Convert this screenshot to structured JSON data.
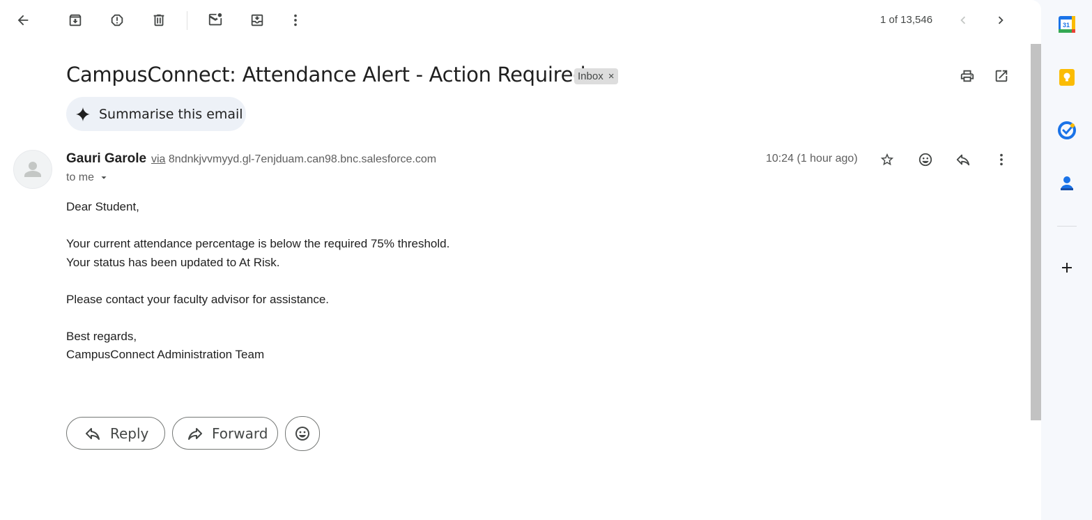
{
  "toolbar": {
    "back": "back-arrow-icon",
    "archive": "archive-icon",
    "report_spam": "report-spam-icon",
    "delete": "delete-icon",
    "mark_unread": "mark-unread-icon",
    "move_to": "move-to-icon",
    "more": "more-vert-icon"
  },
  "pager": {
    "text": "1 of 13,546"
  },
  "email": {
    "subject": "CampusConnect: Attendance Alert - Action Required",
    "label": "Inbox",
    "label_remove": "×",
    "summarise_label": "Summarise this email",
    "sender_name": "Gauri Garole",
    "via_word": "via",
    "via_domain": "8ndnkjvvmyyd.gl-7enjduam.can98.bnc.salesforce.com",
    "recipient": "to me",
    "time": "10:24 (1 hour ago)",
    "body": {
      "greeting": "Dear Student,",
      "line1": "Your current attendance percentage is below the required 75% threshold.",
      "line2": "Your status has been updated to At Risk.",
      "line3": "Please contact your faculty advisor for assistance.",
      "closing": "Best regards,",
      "signature": "CampusConnect Administration Team"
    }
  },
  "actions": {
    "reply": "Reply",
    "forward": "Forward"
  },
  "colors": {
    "calendar_blue": "#1a73e8",
    "keep_yellow": "#fbbc04",
    "tasks_blue": "#1a73e8",
    "contacts_blue": "#1a73e8"
  }
}
